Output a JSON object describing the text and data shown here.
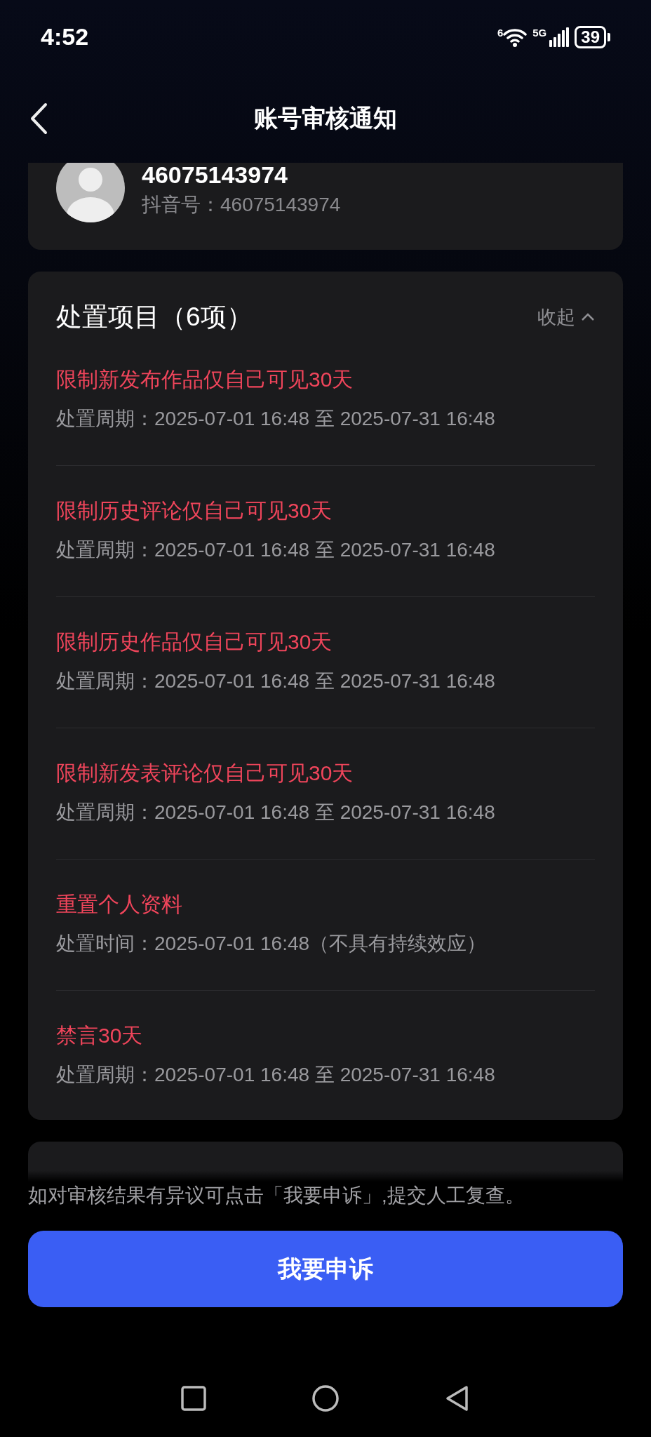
{
  "status_bar": {
    "time": "4:52",
    "wifi_label": "6",
    "network": "5G",
    "battery": "39"
  },
  "header": {
    "title": "账号审核通知"
  },
  "profile": {
    "name": "46075143974",
    "id_label": "抖音号：46075143974"
  },
  "disposal": {
    "title": "处置项目（6项）",
    "toggle": "收起",
    "expanded": true,
    "items": [
      {
        "title": "限制新发布作品仅自己可见30天",
        "detail": "处置周期：2025-07-01 16:48 至 2025-07-31 16:48"
      },
      {
        "title": "限制历史评论仅自己可见30天",
        "detail": "处置周期：2025-07-01 16:48 至 2025-07-31 16:48"
      },
      {
        "title": "限制历史作品仅自己可见30天",
        "detail": "处置周期：2025-07-01 16:48 至 2025-07-31 16:48"
      },
      {
        "title": "限制新发表评论仅自己可见30天",
        "detail": "处置周期：2025-07-01 16:48 至 2025-07-31 16:48"
      },
      {
        "title": "重置个人资料",
        "detail": "处置时间：2025-07-01 16:48（不具有持续效应）"
      },
      {
        "title": "禁言30天",
        "detail": "处置周期：2025-07-01 16:48 至 2025-07-31 16:48"
      }
    ]
  },
  "notice": "如对审核结果有异议可点击「我要申诉」,提交人工复查。",
  "appeal_button": "我要申诉"
}
